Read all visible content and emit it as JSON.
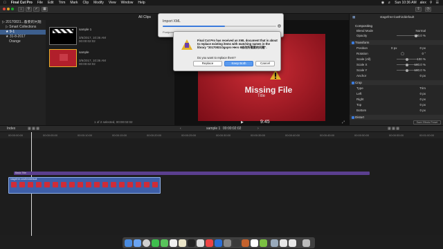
{
  "menubar": {
    "apple": "",
    "app_name": "Final Cut Pro",
    "items": [
      "File",
      "Edit",
      "Trim",
      "Mark",
      "Clip",
      "Modify",
      "View",
      "Window",
      "Help"
    ],
    "clock": "Sun 10:36 AM",
    "user": "alex"
  },
  "sidebar": {
    "items": [
      {
        "label": "20170831...备要的问题"
      },
      {
        "label": "Smart Collections"
      },
      {
        "label": "9-1"
      },
      {
        "label": "31-8-2017"
      },
      {
        "label": "Orange"
      }
    ]
  },
  "browser": {
    "filter": "All Clips",
    "clips": [
      {
        "name": "sample 1",
        "date": "3/6/2017, 10:36 AM",
        "duration": "00:00:02:02"
      },
      {
        "name": "sample",
        "date": "3/6/2017, 10:36 AM",
        "duration": "00:00:02:02"
      }
    ],
    "status": "1 of 2 selected, 00:00:02:02"
  },
  "viewer": {
    "missing_text": "Missing File",
    "sub_text": "Title",
    "timecode": "9:45",
    "zoom": "1"
  },
  "import_dialog": {
    "title": "Import XML",
    "progress": 0.55,
    "status": "Postpone..."
  },
  "alert": {
    "message": "Final Cut Pro has received an XML document that is about to replace existing items with matching names in the library \"20170831Ogopro Hero 8修改所需要的问题\".",
    "question": "Do you want to replace them?",
    "buttons": [
      "Replace",
      "Keep Both",
      "Cancel"
    ]
  },
  "inspector": {
    "clip_name": "stagefree-lowthirddefault",
    "sections": {
      "compositing": "Compositing",
      "blend_mode_label": "Blend Mode",
      "blend_mode_value": "Normal",
      "opacity_label": "Opacity",
      "opacity_value": "100.0 %",
      "transform": "Transform",
      "position_label": "Position",
      "position_x": "0 px",
      "position_y": "0 px",
      "rotation_label": "Rotation",
      "rotation_value": "0 °",
      "scale_all_label": "Scale (All)",
      "scale_all_value": "100 %",
      "scale_x_label": "Scale X",
      "scale_x_value": "100.0 %",
      "scale_y_label": "Scale Y",
      "scale_y_value": "100.0 %",
      "anchor_label": "Anchor",
      "anchor_value": "0 px",
      "crop": "Crop",
      "crop_type_label": "Type",
      "crop_type_value": "Trim",
      "left_label": "Left",
      "left_value": "0 px",
      "right_label": "Right",
      "right_value": "0 px",
      "top_label": "Top",
      "top_value": "0 px",
      "bottom_label": "Bottom",
      "bottom_value": "0 px",
      "distort": "Distort",
      "save_preset": "Save Effects Preset"
    }
  },
  "timeline": {
    "index_label": "Index",
    "project": "sample 1",
    "project_duration": "00:00:02:02",
    "title_clip": "Basic Title",
    "video_clip": "stagefree-lowthirddefault",
    "ruler": [
      "00:00:00:00",
      "00:00:05:00",
      "00:00:10:00",
      "00:00:15:00",
      "00:00:20:00",
      "00:00:25:00",
      "00:00:30:00",
      "00:00:35:00",
      "00:00:40:00",
      "00:00:45:00",
      "00:00:50:00",
      "00:00:55:00",
      "00:01:00:00",
      "00:01:05:00"
    ]
  },
  "colors": {
    "accent": "#3b7bdc",
    "title_clip": "#5b3f8f",
    "video_clip": "#3e5fa8",
    "missing_red": "#b11f2b"
  }
}
